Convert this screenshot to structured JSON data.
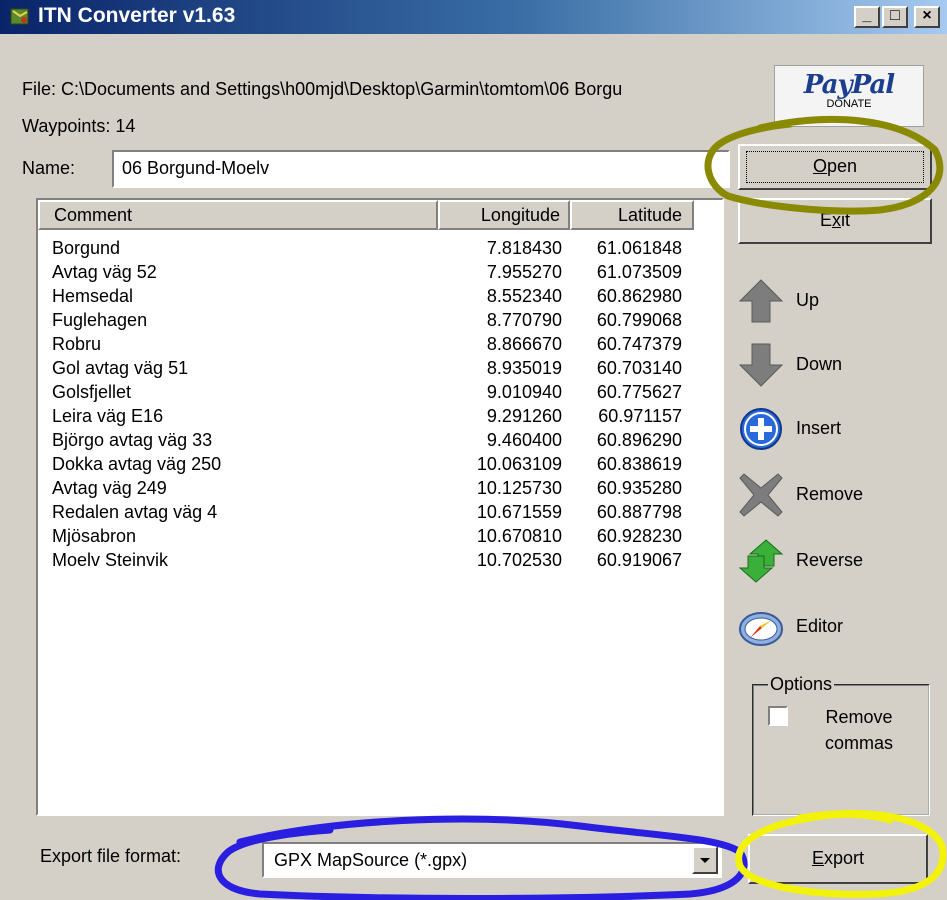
{
  "window": {
    "title": "ITN Converter v1.63",
    "title_buttons": {
      "minimize": "_",
      "maximize": "□",
      "close": "×"
    }
  },
  "file": {
    "text": "File: C:\\Documents and Settings\\h00mjd\\Desktop\\Garmin\\tomtom\\06 Borgu"
  },
  "waypoints": {
    "text": "Waypoints: 14"
  },
  "name": {
    "label": "Name:",
    "value": "06 Borgund-Moelv"
  },
  "paypal": {
    "logo": "PayPal",
    "sub": "DONATE"
  },
  "buttons": {
    "open_prefix": "O",
    "open_rest": "pen",
    "exit_prefix": "E",
    "exit_underlined": "x",
    "exit_rest": "it",
    "export_prefix": "E",
    "export_rest": "xport"
  },
  "side_buttons": {
    "up": "Up",
    "down": "Down",
    "insert": "Insert",
    "remove": "Remove",
    "reverse": "Reverse",
    "editor": "Editor"
  },
  "options": {
    "legend": "Options",
    "remove_commas_label": "Remove commas",
    "remove_commas_checked": false
  },
  "table": {
    "columns": [
      "Comment",
      "Longitude",
      "Latitude"
    ],
    "rows": [
      [
        "Borgund",
        "7.818430",
        "61.061848"
      ],
      [
        "Avtag väg 52",
        "7.955270",
        "61.073509"
      ],
      [
        "Hemsedal",
        "8.552340",
        "60.862980"
      ],
      [
        "Fuglehagen",
        "8.770790",
        "60.799068"
      ],
      [
        "Robru",
        "8.866670",
        "60.747379"
      ],
      [
        "Gol avtag väg 51",
        "8.935019",
        "60.703140"
      ],
      [
        "Golsfjellet",
        "9.010940",
        "60.775627"
      ],
      [
        "Leira väg E16",
        "9.291260",
        "60.971157"
      ],
      [
        "Björgo avtag väg 33",
        "9.460400",
        "60.896290"
      ],
      [
        "Dokka avtag väg 250",
        "10.063109",
        "60.838619"
      ],
      [
        "Avtag väg 249",
        "10.125730",
        "60.935280"
      ],
      [
        "Redalen avtag väg 4",
        "10.671559",
        "60.887798"
      ],
      [
        "Mjösabron",
        "10.670810",
        "60.928230"
      ],
      [
        "Moelv Steinvik",
        "10.702530",
        "60.919067"
      ]
    ]
  },
  "export_format": {
    "label": "Export file format:",
    "selected": "GPX MapSource (*.gpx)"
  },
  "colors": {
    "titlebar_start": "#0a246a",
    "titlebar_end": "#a6caf0",
    "face": "#d4d0c8",
    "annotation_olive": "#8a8a00",
    "annotation_blue": "#2a1ee0",
    "annotation_yellow": "#f2f20a"
  }
}
